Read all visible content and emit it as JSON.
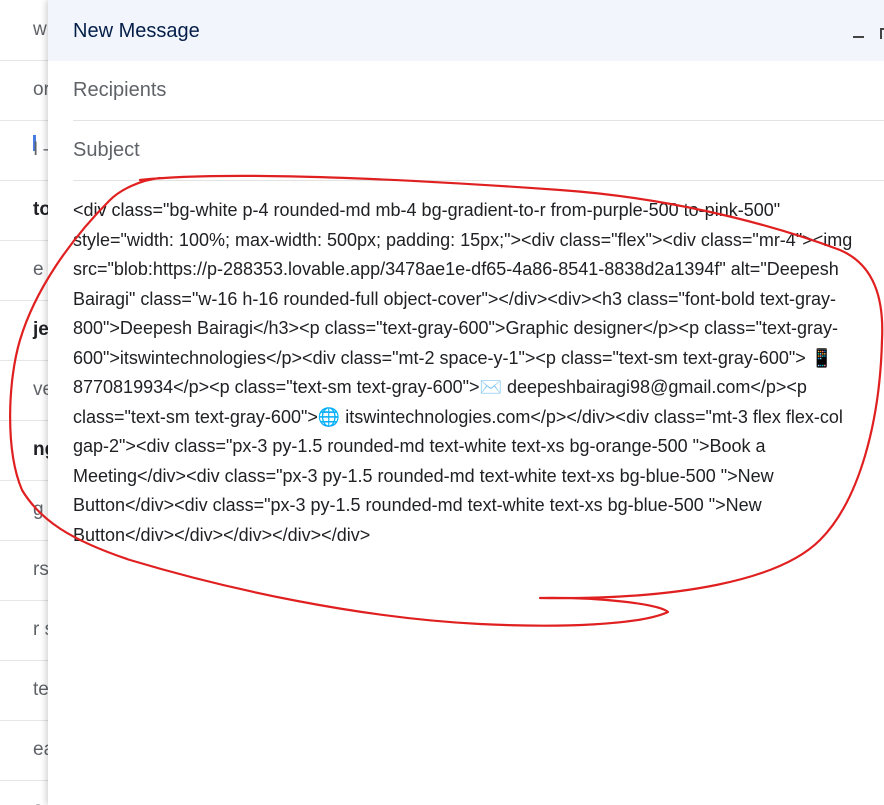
{
  "background": {
    "rows": [
      {
        "text": "w",
        "bold": false
      },
      {
        "text": "or",
        "bold": false
      },
      {
        "text": "I –",
        "bold": false
      },
      {
        "text": "to",
        "bold": true
      },
      {
        "text": "e",
        "bold": false
      },
      {
        "text": "je",
        "bold": true
      },
      {
        "text": "ve",
        "bold": false
      },
      {
        "text": "ng",
        "bold": true
      },
      {
        "text": "g",
        "bold": false
      },
      {
        "text": "rs",
        "bold": false
      },
      {
        "text": "r s",
        "bold": false
      },
      {
        "text": "te",
        "bold": false
      },
      {
        "text": "ea",
        "bold": false
      },
      {
        "text": "a",
        "bold": false
      }
    ]
  },
  "compose": {
    "title": "New Message",
    "recipients_placeholder": "Recipients",
    "subject_placeholder": "Subject",
    "body_lines": [
      "<div class=\"bg-white p-4 rounded-md mb-4 bg-gradient-to-r from-purple-500 to-pink-500\"",
      "style=\"width: 100%; max-width: 500px; padding: 15px;\"><div class=\"flex\"><div class=\"mr-4\"><img",
      "src=\"blob:https://p-288353.lovable.app/3478ae1e-df65-4a86-8541-8838d2a1394f\" alt=\"Deepesh",
      "Bairagi\" class=\"w-16 h-16 rounded-full object-cover\"></div><div><h3 class=\"font-bold text-gray-",
      "800\">Deepesh Bairagi</h3><p class=\"text-gray-600\">Graphic designer</p><p class=\"text-gray-",
      "600\">itswintechnologies</p><div class=\"mt-2 space-y-1\"><p class=\"text-sm text-gray-600\"> 📱",
      "8770819934</p><p class=\"text-sm text-gray-600\">✉️ deepeshbairagi98@gmail.com</p><p",
      "class=\"text-sm text-gray-600\">🌐 itswintechnologies.com</p></div><div class=\"mt-3 flex flex-col",
      "gap-2\"><div class=\"px-3 py-1.5 rounded-md text-white text-xs bg-orange-500 \">Book a",
      "Meeting</div><div class=\"px-3 py-1.5 rounded-md text-white text-xs bg-blue-500 \">New",
      "Button</div><div class=\"px-3 py-1.5 rounded-md text-white text-xs bg-blue-500 \">New",
      "Button</div></div></div></div></div>"
    ]
  },
  "annotation": {
    "color": "#e02020"
  }
}
